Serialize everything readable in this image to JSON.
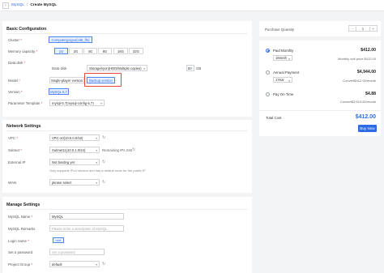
{
  "breadcrumb": {
    "back_icon": "chevron-left-icon",
    "parent": "MySQL",
    "separator": "/",
    "current": "Create MySQL"
  },
  "basic": {
    "title": "Basic Configuration",
    "cluster_label": "Cluster",
    "cluster_value": "Computerjyogoo(cd6_lfn)",
    "memory_label": "Memory capacity",
    "memory_options": [
      "1G",
      "2G",
      "4G",
      "8G",
      "16G",
      "32G"
    ],
    "memory_selected": "1G",
    "disk_label": "Data disk",
    "disk_sub_label": "Data disk",
    "disk_type": "Storagehyon(HDD/Multiple copies)",
    "disk_size": "50",
    "disk_unit": "GB",
    "model_label": "Model",
    "model_options": [
      "Single-player version",
      "Backup version"
    ],
    "model_selected": "Backup version",
    "version_label": "Version",
    "version_value": "MySQL 5.7",
    "template_label": "Parameter Template",
    "template_value": "mysql-5.7(mysql-config-5.7)"
  },
  "network": {
    "title": "Network Settings",
    "vpc_label": "VPC",
    "vpc_value": "VPC-10(10.0.0.0/16)",
    "subnet_label": "Subnet",
    "subnet_value": "Subnet11(10.0.1.0/24)",
    "subnet_remaining": "Remaining IPs 246",
    "eip_label": "External IP",
    "eip_value": "Not binding yet",
    "eip_hint": "Only supports IPv4 version and has a default route for the public IP",
    "wan_label": "WAN",
    "wan_value": "please select"
  },
  "manage": {
    "title": "Manage Settings",
    "name_label": "MySQL Name",
    "name_value": "MySQL",
    "remarks_label": "MySQL Remarks",
    "remarks_placeholder": "Please enter a description of MySQL",
    "login_label": "Login name",
    "login_value": "root",
    "password_label": "Set a password",
    "password_placeholder": "Set a password",
    "group_label": "Project Group",
    "group_value": "default"
  },
  "purchase": {
    "qty_label": "Purchase Quantity",
    "qty_minus": "-",
    "qty_value": "1",
    "qty_plus": "+",
    "options": [
      {
        "label": "Paid Monthly",
        "price": "$412.00",
        "period": "1Month",
        "note": "Monthly unit price $412.00",
        "selected": true
      },
      {
        "label": "Annual Payment",
        "price": "$4,944.00",
        "period": "1Year",
        "note": "Convert$412.00/month",
        "selected": false
      },
      {
        "label": "Pay On Time",
        "price": "$4.88",
        "period": "",
        "note": "Convert$3,513.60/month",
        "selected": false
      }
    ],
    "total_label": "Total Cost",
    "total_value": "$412.00",
    "buy_label": "Buy Now"
  },
  "colors": {
    "accent": "#2e6be6",
    "highlight": "#e5483a"
  }
}
